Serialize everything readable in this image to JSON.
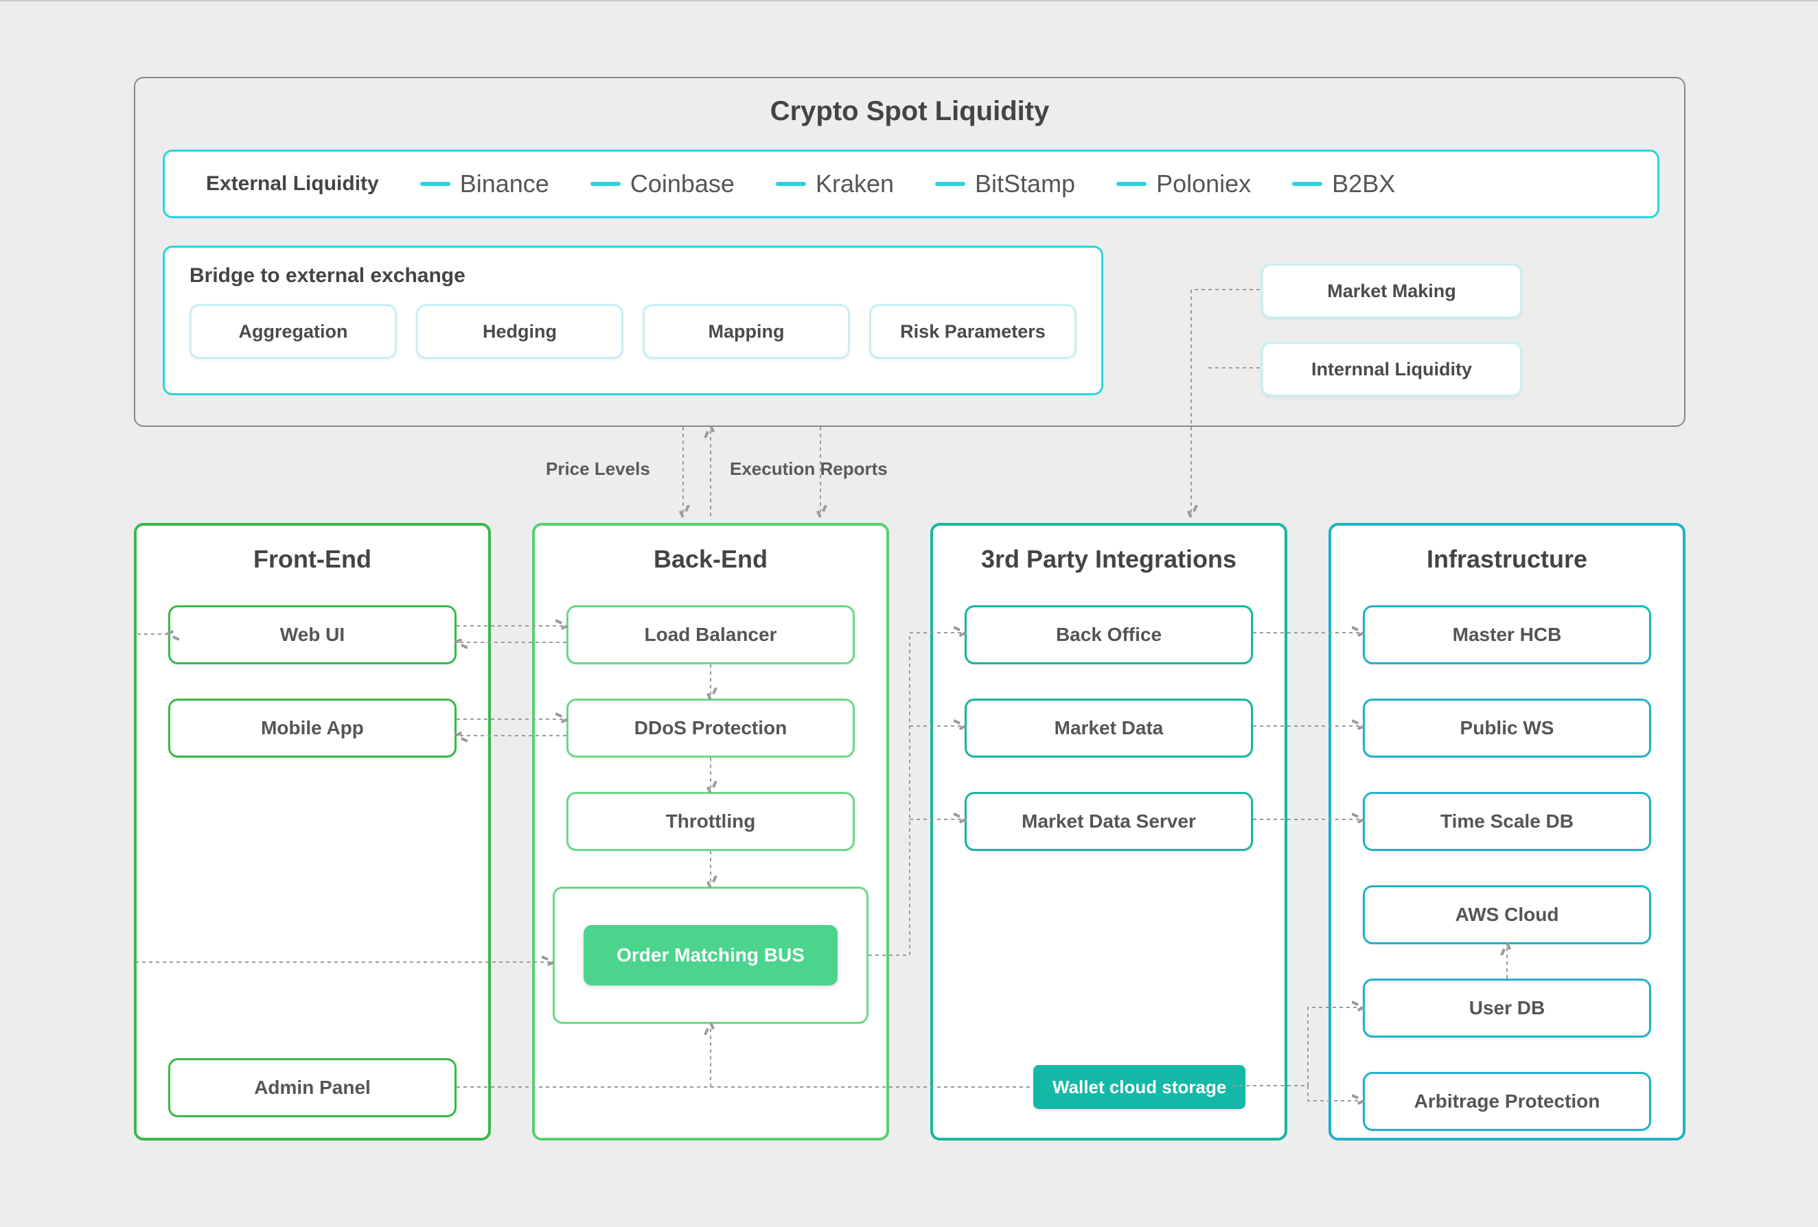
{
  "top": {
    "title": "Crypto Spot Liquidity",
    "liquidity_label": "External Liquidity",
    "exchanges": [
      "Binance",
      "Coinbase",
      "Kraken",
      "BitStamp",
      "Poloniex",
      "B2BX"
    ],
    "bridge_title": "Bridge to external exchange",
    "bridge_items": [
      "Aggregation",
      "Hedging",
      "Mapping",
      "Risk Parameters"
    ],
    "mm": "Market Making",
    "il": "Internnal Liquidity"
  },
  "labels": {
    "price_levels": "Price Levels",
    "exec_reports": "Execution Reports"
  },
  "cols": {
    "frontend": {
      "title": "Front-End",
      "items": [
        "Web UI",
        "Mobile App",
        "Admin Panel"
      ]
    },
    "backend": {
      "title": "Back-End",
      "items": [
        "Load Balancer",
        "DDoS Protection",
        "Throttling"
      ],
      "bus": "Order Matching BUS"
    },
    "third": {
      "title": "3rd Party Integrations",
      "items": [
        "Back Office",
        "Market Data",
        "Market Data Server"
      ],
      "wallet": "Wallet cloud storage"
    },
    "infra": {
      "title": "Infrastructure",
      "items": [
        "Master HCB",
        "Public WS",
        "Time Scale DB",
        "AWS Cloud",
        "User DB",
        "Arbitrage Protection"
      ]
    }
  }
}
